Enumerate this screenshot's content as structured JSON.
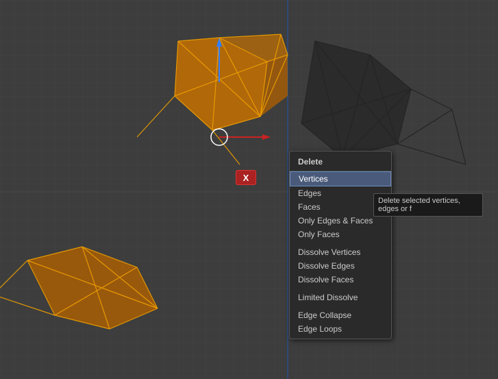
{
  "viewport": {
    "background_color": "#3d3d3d"
  },
  "x_button": {
    "label": "X"
  },
  "context_menu": {
    "title": "Delete",
    "items": [
      {
        "id": "vertices",
        "label": "Vertices",
        "highlighted": true,
        "separator_before": false
      },
      {
        "id": "edges",
        "label": "Edges",
        "highlighted": false,
        "separator_before": false
      },
      {
        "id": "faces",
        "label": "Faces",
        "highlighted": false,
        "separator_before": false
      },
      {
        "id": "only-edges-faces",
        "label": "Only Edges & Faces",
        "highlighted": false,
        "separator_before": false
      },
      {
        "id": "only-faces",
        "label": "Only Faces",
        "highlighted": false,
        "separator_before": false
      },
      {
        "id": "dissolve-vertices",
        "label": "Dissolve Vertices",
        "highlighted": false,
        "separator_before": true
      },
      {
        "id": "dissolve-edges",
        "label": "Dissolve Edges",
        "highlighted": false,
        "separator_before": false
      },
      {
        "id": "dissolve-faces",
        "label": "Dissolve Faces",
        "highlighted": false,
        "separator_before": false
      },
      {
        "id": "limited-dissolve",
        "label": "Limited Dissolve",
        "highlighted": false,
        "separator_before": true
      },
      {
        "id": "edge-collapse",
        "label": "Edge Collapse",
        "highlighted": false,
        "separator_before": true
      },
      {
        "id": "edge-loops",
        "label": "Edge Loops",
        "highlighted": false,
        "separator_before": false
      }
    ]
  },
  "tooltip": {
    "text": "Delete selected vertices, edges or f"
  }
}
